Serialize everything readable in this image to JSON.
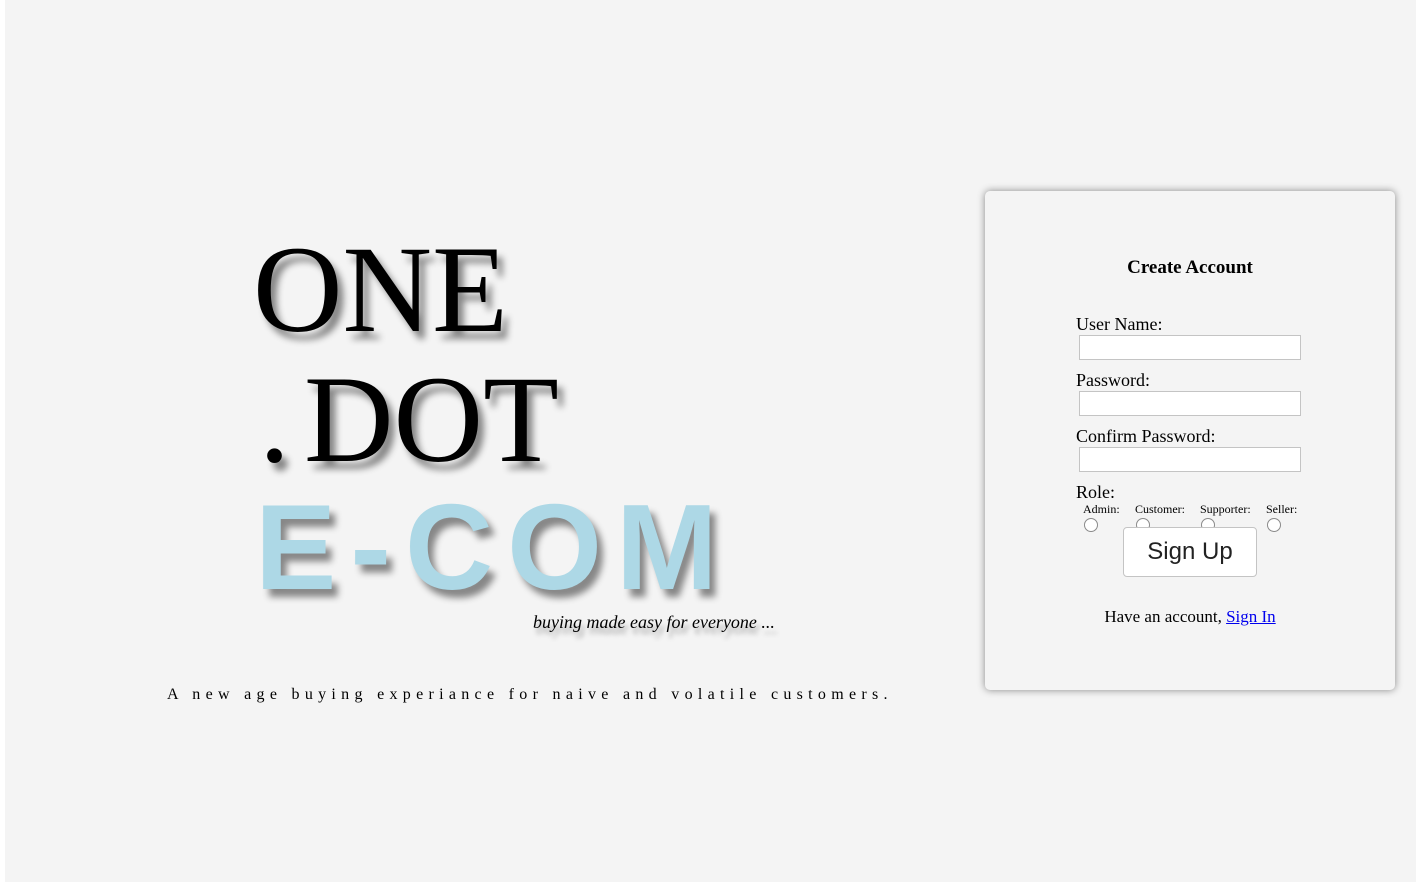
{
  "brand": {
    "line1": "ONE",
    "line2_period": ".",
    "line2_word": "DOT",
    "line3": "E-COM",
    "slogan": "buying made easy for everyone ...",
    "tagline": "A new age buying experiance for naive and volatile customers."
  },
  "signup_form": {
    "title": "Create Account",
    "username_label": "User Name:",
    "username_value": "",
    "password_label": "Password:",
    "password_value": "",
    "confirm_password_label": "Confirm Password:",
    "confirm_password_value": "",
    "role_label": "Role:",
    "roles": [
      "Admin:",
      "Customer:",
      "Supporter:",
      "Seller:"
    ],
    "submit_label": "Sign Up",
    "have_account_text": "Have an account,",
    "signin_link": "Sign In"
  },
  "colors": {
    "page_background": "#f4f4f4",
    "ecom_accent": "#add8e6",
    "link": "#0000ee"
  }
}
